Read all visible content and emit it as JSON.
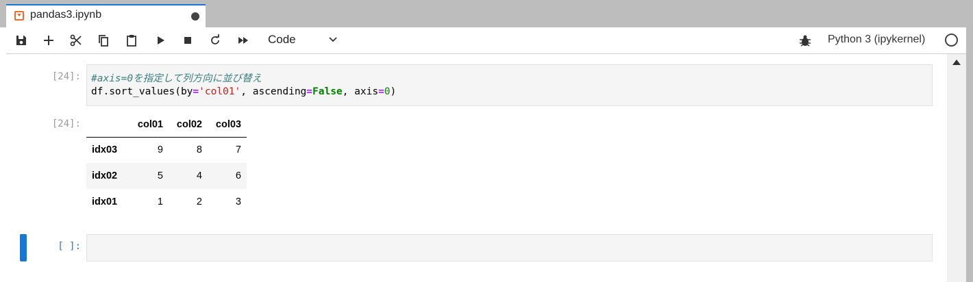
{
  "tab": {
    "title": "pandas3.ipynb"
  },
  "toolbar": {
    "buttons": [
      "save-icon",
      "plus-icon",
      "scissors-icon",
      "copy-icon",
      "paste-icon",
      "run-icon",
      "stop-icon",
      "restart-icon",
      "fast-forward-icon"
    ],
    "cell_type": "Code",
    "kernel": "Python 3 (ipykernel)"
  },
  "cells": [
    {
      "prompt": "[24]:",
      "code": {
        "comment": "#axis=0を指定して列方向に並び替え",
        "line2": {
          "prefix": "df.sort_values(by",
          "eq1": "=",
          "str": "'col01'",
          "mid": ", ascending",
          "eq2": "=",
          "kw": "False",
          "mid2": ", axis",
          "eq3": "=",
          "num": "0",
          "suffix": ")"
        }
      },
      "output_prompt": "[24]:",
      "output_table": {
        "columns": [
          "",
          "col01",
          "col02",
          "col03"
        ],
        "rows": [
          {
            "index": "idx03",
            "values": [
              "9",
              "8",
              "7"
            ]
          },
          {
            "index": "idx02",
            "values": [
              "5",
              "4",
              "6"
            ]
          },
          {
            "index": "idx01",
            "values": [
              "1",
              "2",
              "3"
            ]
          }
        ]
      }
    },
    {
      "prompt": "[ ]:"
    }
  ],
  "colors": {
    "accent": "#1976d2",
    "tab_icon": "#e46e2e",
    "chrome": "#bdbdbd"
  }
}
